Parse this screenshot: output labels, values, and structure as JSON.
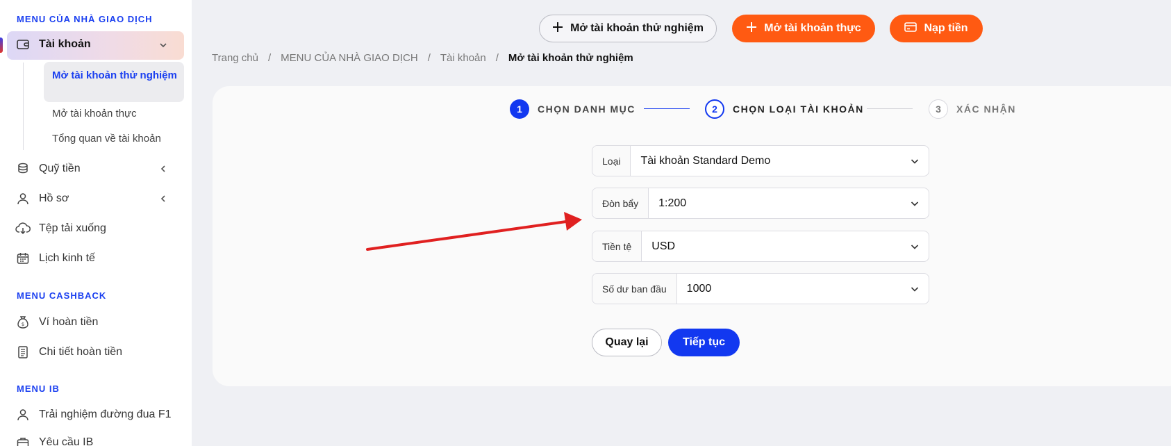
{
  "sidebar": {
    "trader_menu_title": "MENU CỦA NHÀ GIAO DỊCH",
    "account": {
      "label": "Tài khoản",
      "icon": "wallet-icon"
    },
    "account_sub": [
      "Mở tài khoản thử nghiệm",
      "Mở tài khoản thực",
      "Tổng quan về tài khoản"
    ],
    "items": [
      {
        "label": "Quỹ tiền",
        "icon": "coins-icon"
      },
      {
        "label": "Hồ sơ",
        "icon": "user-icon"
      },
      {
        "label": "Tệp tải xuống",
        "icon": "cloud-download-icon"
      },
      {
        "label": "Lịch kinh tế",
        "icon": "calendar-icon"
      }
    ],
    "cashback_title": "MENU CASHBACK",
    "cashback_items": [
      {
        "label": "Ví hoàn tiền",
        "icon": "money-bag-icon"
      },
      {
        "label": "Chi tiết hoàn tiền",
        "icon": "document-icon"
      }
    ],
    "ib_title": "MENU IB",
    "ib_items": [
      {
        "label": "Trải nghiệm đường đua F1",
        "icon": "user-icon"
      },
      {
        "label": "Yêu cầu IB",
        "icon": "briefcase-icon"
      }
    ]
  },
  "header": {
    "demo_button": "Mở tài khoản thử nghiệm",
    "real_button": "Mở tài khoản thực",
    "deposit_button": "Nạp tiền"
  },
  "breadcrumb": [
    "Trang chủ",
    "MENU CỦA NHÀ GIAO DỊCH",
    "Tài khoản",
    "Mở tài khoản thử nghiệm"
  ],
  "stepper": [
    {
      "num": "1",
      "label": "CHỌN DANH MỤC"
    },
    {
      "num": "2",
      "label": "CHỌN LOẠI TÀI KHOẢN"
    },
    {
      "num": "3",
      "label": "XÁC NHẬN"
    }
  ],
  "form": {
    "type": {
      "label": "Loại",
      "value": "Tài khoản Standard Demo"
    },
    "leverage": {
      "label": "Đòn bẩy",
      "value": "1:200"
    },
    "currency": {
      "label": "Tiền tệ",
      "value": "USD"
    },
    "balance": {
      "label": "Số dư ban đầu",
      "value": "1000"
    },
    "back_button": "Quay lại",
    "next_button": "Tiếp tục"
  },
  "colors": {
    "accent_blue": "#1238f0",
    "accent_orange": "#ff5a12",
    "annotation_red": "#e02020"
  }
}
